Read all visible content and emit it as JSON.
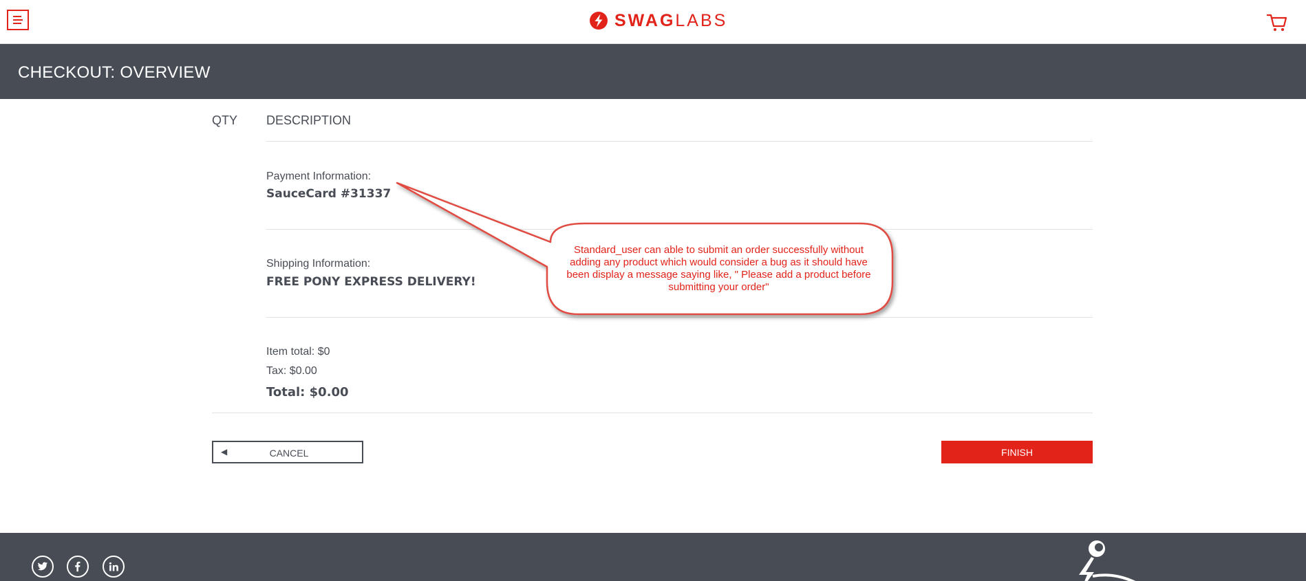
{
  "header": {
    "logo_bold": "SWAG",
    "logo_light": "LABS",
    "menu_icon": "hamburger-menu-icon",
    "cart_icon": "shopping-cart-icon"
  },
  "subheader": {
    "title": "CHECKOUT: OVERVIEW"
  },
  "cart_list": {
    "qty_label": "QTY",
    "description_label": "DESCRIPTION",
    "items": []
  },
  "summary": {
    "payment_label": "Payment Information:",
    "payment_value": "SauceCard #31337",
    "shipping_label": "Shipping Information:",
    "shipping_value": "FREE PONY EXPRESS DELIVERY!",
    "item_total": "Item total: $0",
    "tax": "Tax: $0.00",
    "total": "Total: $0.00"
  },
  "actions": {
    "cancel_label": "CANCEL",
    "finish_label": "FINISH"
  },
  "annotation": {
    "text": "Standard_user can able to submit an order successfully without adding any product which would consider a bug as it should have been display a message saying like, \" Please add a product before submitting your order\""
  },
  "footer": {
    "social": [
      {
        "name": "twitter",
        "icon": "twitter-icon"
      },
      {
        "name": "facebook",
        "icon": "facebook-icon"
      },
      {
        "name": "linkedin",
        "icon": "linkedin-icon"
      }
    ]
  },
  "colors": {
    "brand_red": "#e2231a",
    "dark_bar": "#474c55",
    "text": "#484c55",
    "divider": "#e2e2e2"
  }
}
